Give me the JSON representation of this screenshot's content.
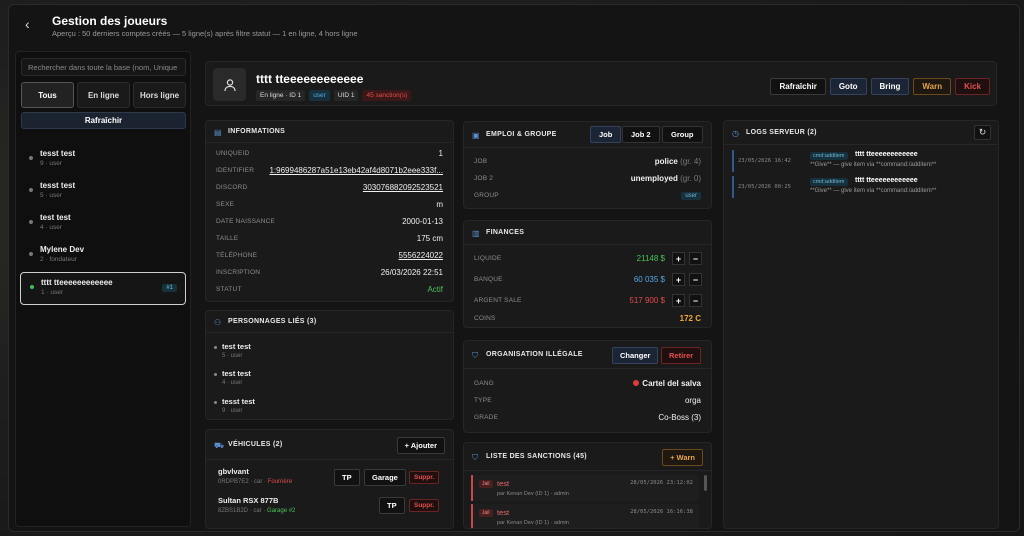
{
  "header": {
    "title": "Gestion des joueurs",
    "subtitle": "Aperçu : 50 derniers comptes créés — 5 ligne(s) après filtre statut — 1 en ligne, 4 hors ligne"
  },
  "sidebar": {
    "search_placeholder": "Rechercher dans toute la base (nom, Unique",
    "tabs": [
      "Tous",
      "En ligne",
      "Hors ligne"
    ],
    "refresh_label": "Rafraîchir",
    "players": [
      {
        "name": "tesst test",
        "meta": "9 · user"
      },
      {
        "name": "tesst test",
        "meta": "5 · user"
      },
      {
        "name": "test test",
        "meta": "4 · user"
      },
      {
        "name": "Mylene Dev",
        "meta": "2 · fondateur"
      },
      {
        "name": "tttt tteeeeeeeeeeee",
        "meta": "1 · user",
        "badge": "#1"
      }
    ]
  },
  "player": {
    "name": "tttt tteeeeeeeeeeee",
    "chips": [
      "En ligne · ID 1",
      "user",
      "UID 1",
      "45 sanction(s)"
    ],
    "actions": [
      "Rafraîchir",
      "Goto",
      "Bring",
      "Warn",
      "Kick"
    ]
  },
  "info": {
    "title": "INFORMATIONS",
    "rows": [
      {
        "k": "UNIQUEID",
        "v": "1"
      },
      {
        "k": "IDENTIFIER",
        "v": "1:9699486287a51e13eb42af4d8071b2eee333f..."
      },
      {
        "k": "DISCORD",
        "v": "303076882092523521"
      },
      {
        "k": "SEXE",
        "v": "m"
      },
      {
        "k": "DATE NAISSANCE",
        "v": "2000-01-13"
      },
      {
        "k": "TAILLE",
        "v": "175 cm"
      },
      {
        "k": "TÉLÉPHONE",
        "v": "5556224022"
      },
      {
        "k": "INSCRIPTION",
        "v": "26/03/2026 22:51"
      },
      {
        "k": "STATUT",
        "v": "Actif"
      }
    ]
  },
  "linked": {
    "title": "PERSONNAGES LIÉS (3)",
    "items": [
      {
        "name": "test test",
        "meta": "5 · user"
      },
      {
        "name": "test test",
        "meta": "4 · user"
      },
      {
        "name": "tesst test",
        "meta": "9 · user"
      }
    ]
  },
  "vehicles": {
    "title": "VÉHICULES (2)",
    "add_label": "+ Ajouter",
    "items": [
      {
        "name": "gbvlvant",
        "meta": "0RDPB7E2 · car",
        "status": "Fourrière",
        "btns": [
          "TP",
          "Garage",
          "Suppr."
        ]
      },
      {
        "name": "Sultan RSX 877B",
        "meta": "8ZBS1B2D · car",
        "status": "Garage #2",
        "btns": [
          "TP",
          "Suppr."
        ]
      }
    ]
  },
  "job": {
    "title": "EMPLOI & GROUPE",
    "tabs": [
      "Job",
      "Job 2",
      "Group"
    ],
    "rows": [
      {
        "k": "JOB",
        "v": "police",
        "g": "(gr. 4)"
      },
      {
        "k": "JOB 2",
        "v": "unemployed",
        "g": "(gr. 0)"
      },
      {
        "k": "GROUP",
        "v": "user"
      }
    ]
  },
  "finances": {
    "title": "FINANCES",
    "rows": [
      {
        "k": "LIQUIDE",
        "v": "21148 $"
      },
      {
        "k": "BANQUE",
        "v": "60 035 $"
      },
      {
        "k": "ARGENT SALE",
        "v": "517 900 $"
      },
      {
        "k": "COINS",
        "v": "172 C"
      }
    ],
    "plus": "+",
    "minus": "−"
  },
  "org": {
    "title": "ORGANISATION ILLÉGALE",
    "change_label": "Changer",
    "remove_label": "Retirer",
    "rows": [
      {
        "k": "GANG",
        "v": "Cartel del salva"
      },
      {
        "k": "TYPE",
        "v": "orga"
      },
      {
        "k": "GRADE",
        "v": "Co-Boss (3)"
      }
    ]
  },
  "sanctions": {
    "title": "LISTE DES SANCTIONS (45)",
    "warn_label": "+ Warn",
    "items": [
      {
        "tag": "Jail",
        "name": "test",
        "by": "par Kenan Dev (ID 1) · admin",
        "date": "28/05/2026 23:12:02"
      },
      {
        "tag": "Jail",
        "name": "test",
        "by": "par Kenan Dev (ID 1) · admin",
        "date": "28/05/2026 16:16:38"
      }
    ]
  },
  "logs": {
    "title": "LOGS SERVEUR (2)",
    "items": [
      {
        "ts": "23/05/2026 16:42",
        "tag": "cmd:additem",
        "who": "tttt tteeeeeeeeeeee",
        "txt": "**Give** — give item via **command:/additem**"
      },
      {
        "ts": "23/05/2026 00:25",
        "tag": "cmd:additem",
        "who": "tttt tteeeeeeeeeeee",
        "txt": "**Give** — give item via **command:/additem**"
      }
    ]
  },
  "colors": {
    "online": "#3fbf4f",
    "accent_blue": "#5a8fd0",
    "warn": "#e5a44a",
    "kick": "#e25050"
  }
}
